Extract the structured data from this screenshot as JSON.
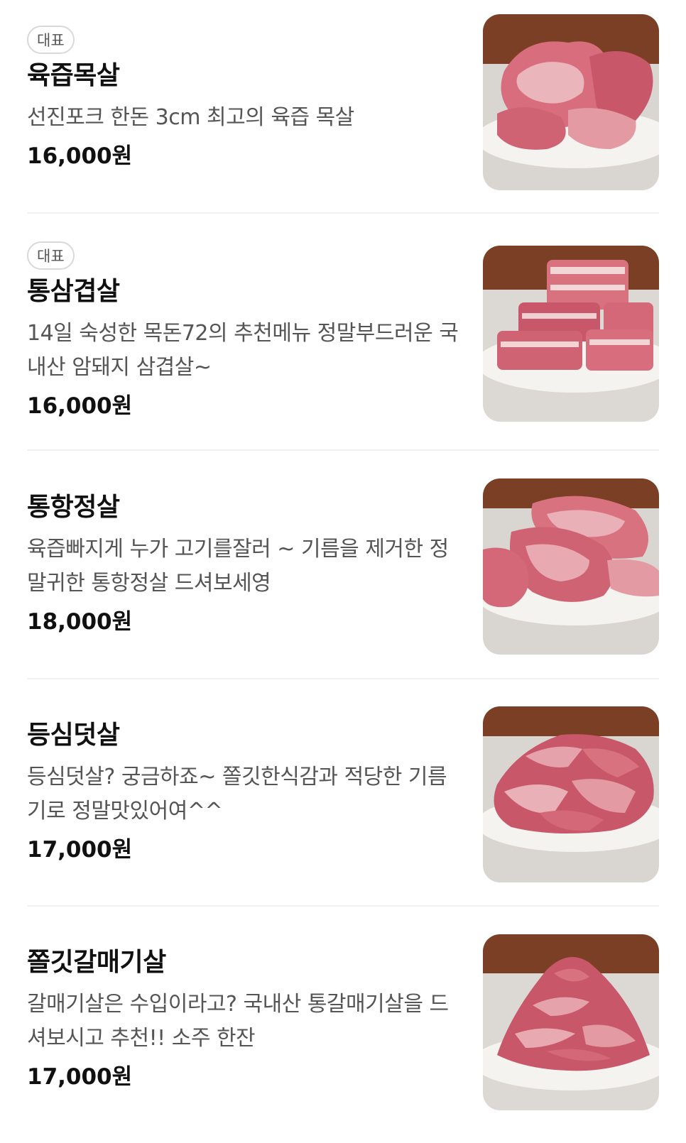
{
  "menu": {
    "items": [
      {
        "badge": "대표",
        "name": "육즙목살",
        "description": "선진포크 한돈 3cm 최고의 육즙 목살",
        "price": "16,000원",
        "image": "pork-neck-plate-photo"
      },
      {
        "badge": "대표",
        "name": "통삼겹살",
        "description": "14일 숙성한 목돈72의 추천메뉴 정말부드러운 국내산 암돼지 삼겹살~",
        "price": "16,000원",
        "image": "pork-belly-plate-photo"
      },
      {
        "name": "통항정살",
        "description": "육즙빠지게 누가 고기를잘러 ~ 기름을 제거한 정말귀한 통항정살 드셔보세영",
        "price": "18,000원",
        "image": "pork-jowl-plate-photo"
      },
      {
        "name": "등심덧살",
        "description": "등심덧살? 궁금하죠~ 쫄깃한식감과 적당한 기름기로 정말맛있어여^^",
        "price": "17,000원",
        "image": "pork-loin-trim-plate-photo"
      },
      {
        "name": "쫄깃갈매기살",
        "description": "갈매기살은 수입이라고? 국내산 통갈매기살을 드셔보시고 추천!! 소주 한잔",
        "price": "17,000원",
        "image": "pork-skirt-plate-photo"
      }
    ]
  },
  "colors": {
    "text": "#111111",
    "description": "#555555",
    "badge_border": "#d9d9d9",
    "divider": "#f1f1f1",
    "wood": "#7a3f25",
    "meat": "#c9576a"
  }
}
